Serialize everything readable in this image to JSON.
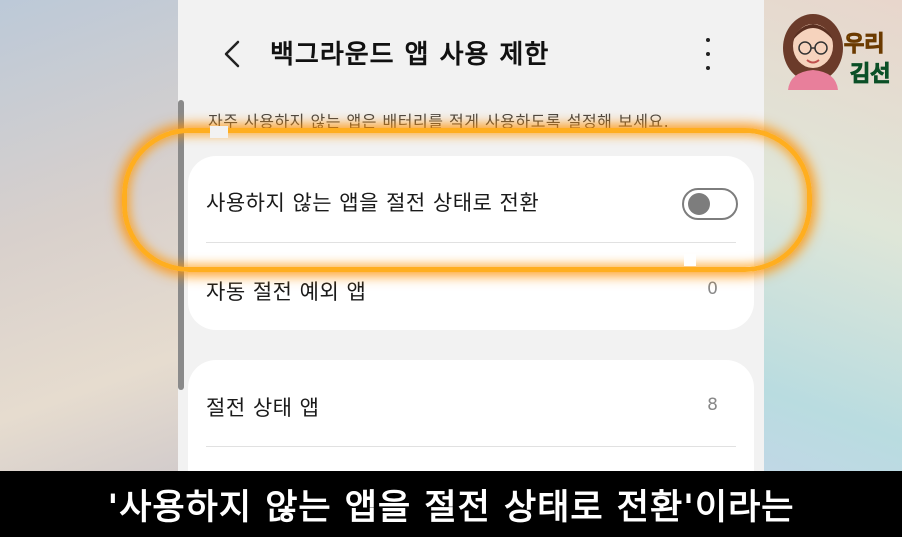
{
  "header": {
    "title": "백그라운드 앱 사용 제한"
  },
  "description": "자주 사용하지 않는 앱은 배터리를 적게 사용하도록 설정해 보세요.",
  "settings": {
    "put_unused_to_sleep": {
      "label": "사용하지 않는 앱을 절전 상태로 전환",
      "enabled": false
    },
    "never_sleeping_apps": {
      "label": "자동 절전 예외 앱",
      "count": "0"
    },
    "sleeping_apps": {
      "label": "절전 상태 앱",
      "count": "8"
    }
  },
  "subtitle": "'사용하지 않는 앱을 절전 상태로 전환'이라는",
  "brand": {
    "line1": "우리",
    "line2": "김선"
  },
  "colors": {
    "highlight": "#ffae1f",
    "subtitle_bg": "#000000"
  }
}
